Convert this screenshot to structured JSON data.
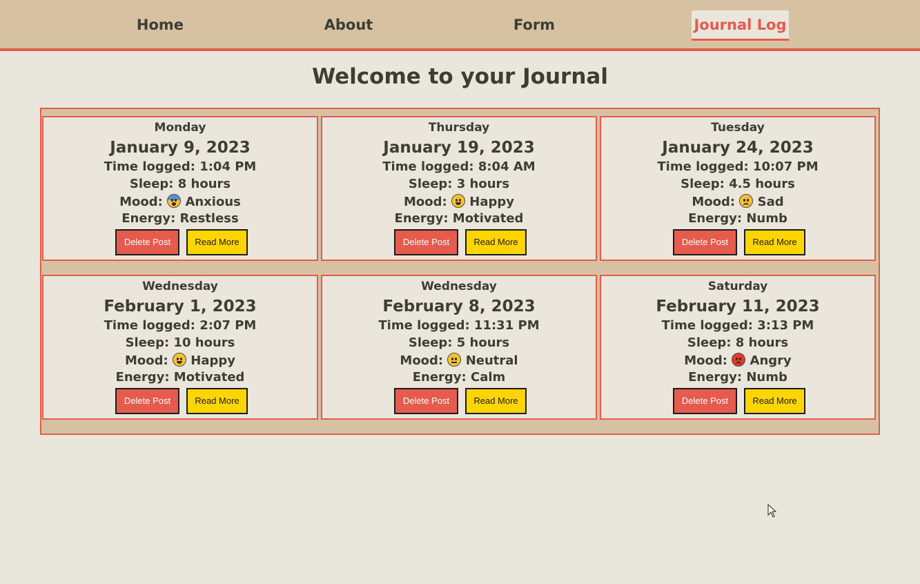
{
  "nav": {
    "items": [
      {
        "label": "Home",
        "active": false
      },
      {
        "label": "About",
        "active": false
      },
      {
        "label": "Form",
        "active": false
      },
      {
        "label": "Journal Log",
        "active": true
      }
    ]
  },
  "page": {
    "title": "Welcome to your Journal"
  },
  "labels": {
    "time": "Time logged: ",
    "sleep": "Sleep: ",
    "mood": "Mood: ",
    "energy": "Energy: ",
    "delete": "Delete Post",
    "read": "Read More"
  },
  "entries": [
    {
      "day": "Monday",
      "date": "January 9, 2023",
      "time": "Time logged: 1:04 PM",
      "sleep": "Sleep: 8 hours",
      "mood_label": "Mood:",
      "mood": "Anxious",
      "mood_icon": "anxious-face-icon",
      "energy": "Energy: Restless"
    },
    {
      "day": "Thursday",
      "date": "January 19, 2023",
      "time": "Time logged: 8:04 AM",
      "sleep": "Sleep: 3 hours",
      "mood_label": "Mood:",
      "mood": "Happy",
      "mood_icon": "happy-face-icon",
      "energy": "Energy: Motivated"
    },
    {
      "day": "Tuesday",
      "date": "January 24, 2023",
      "time": "Time logged: 10:07 PM",
      "sleep": "Sleep: 4.5 hours",
      "mood_label": "Mood:",
      "mood": "Sad",
      "mood_icon": "sad-face-icon",
      "energy": "Energy: Numb"
    },
    {
      "day": "Wednesday",
      "date": "February 1, 2023",
      "time": "Time logged: 2:07 PM",
      "sleep": "Sleep: 10 hours",
      "mood_label": "Mood:",
      "mood": "Happy",
      "mood_icon": "happy-face-icon",
      "energy": "Energy: Motivated"
    },
    {
      "day": "Wednesday",
      "date": "February 8, 2023",
      "time": "Time logged: 11:31 PM",
      "sleep": "Sleep: 5 hours",
      "mood_label": "Mood:",
      "mood": "Neutral",
      "mood_icon": "neutral-face-icon",
      "energy": "Energy: Calm"
    },
    {
      "day": "Saturday",
      "date": "February 11, 2023",
      "time": "Time logged: 3:13 PM",
      "sleep": "Sleep: 8 hours",
      "mood_label": "Mood:",
      "mood": "Angry",
      "mood_icon": "angry-face-icon",
      "energy": "Energy: Numb"
    }
  ],
  "buttons": {
    "delete": "Delete Post",
    "read": "Read More"
  },
  "colors": {
    "background": "#e9e6db",
    "nav": "#d6c2a2",
    "accent": "#e55b4d",
    "read_button": "#ffd500",
    "text": "#3d3d35"
  }
}
